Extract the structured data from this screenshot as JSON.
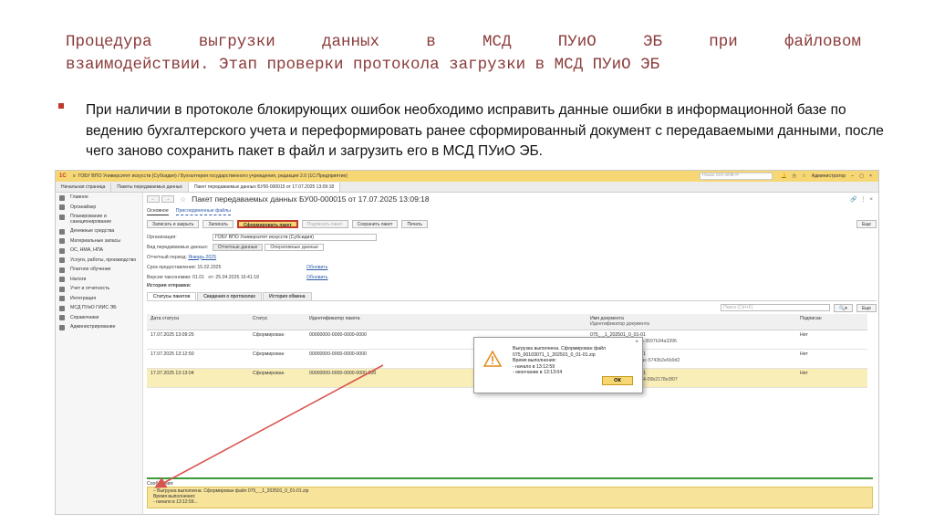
{
  "slide": {
    "title_line1": "Процедура выгрузки данных в МСД ПУиО ЭБ при файловом",
    "title_line2": "взаимодействии. Этап проверки протокола загрузки в МСД ПУиО ЭБ",
    "bullet": "При наличии в протоколе блокирующих ошибок необходимо исправить данные ошибки в информационной базе по ведению бухгалтерского учета и переформировать ранее сформированный документ с передаваемыми данными, после чего заново сохранить пакет в файл и загрузить его в МСД ПУиО ЭБ."
  },
  "colors": {
    "title": "#8b3a3a",
    "bullet": "#c0392b",
    "accent_yellow": "#f7d774",
    "highlight_red": "#c23a2b",
    "arrow_red": "#d9534f"
  },
  "app": {
    "logo": "1С",
    "window_title": "ГОБУ ВПО Университет искусств (Субсидия) / Бухгалтерия государственного учреждения, редакция 2.0 (1С:Предприятие)",
    "search_placeholder": "Поиск Ctrl+Shift+F",
    "user": "Администратор",
    "tabs": [
      "Начальная страница",
      "Пакеты передаваемых данных",
      "Пакет передаваемых данных БУ00-000015 от 17.07.2025 13:09:18"
    ]
  },
  "sidebar": {
    "items": [
      {
        "label": "Главное",
        "icon": "menu-icon"
      },
      {
        "label": "Органайзер",
        "icon": "calendar-icon"
      },
      {
        "label": "Планирование и санкционирование",
        "icon": "plan-icon"
      },
      {
        "label": "Денежные средства",
        "icon": "money-icon"
      },
      {
        "label": "Материальные запасы",
        "icon": "box-icon"
      },
      {
        "label": "ОС, НМА, НПА",
        "icon": "car-icon"
      },
      {
        "label": "Услуги, работы, производство",
        "icon": "tools-icon"
      },
      {
        "label": "Платное обучение",
        "icon": "edu-icon"
      },
      {
        "label": "Налоги",
        "icon": "tax-icon"
      },
      {
        "label": "Учет и отчетность",
        "icon": "report-icon"
      },
      {
        "label": "Интеграция",
        "icon": "integration-icon"
      },
      {
        "label": "МСД ПУиО ГИИС ЭБ",
        "icon": "msd-icon"
      },
      {
        "label": "Справочники",
        "icon": "book-icon"
      },
      {
        "label": "Администрирование",
        "icon": "gear-icon"
      }
    ]
  },
  "doc": {
    "title": "Пакет передаваемых данных БУ00-000015 от 17.07.2025 13:09:18",
    "link_main": "Основное",
    "link_files": "Присоединенные файлы",
    "btn_save_close": "Записать и закрыть",
    "btn_save": "Записать",
    "btn_form": "Сформировать пакет",
    "btn_sign": "Подписать пакет",
    "btn_save_pack": "Сохранить пакет",
    "btn_print": "Печать",
    "btn_more": "Еще",
    "org_label": "Организация:",
    "org_value": "ГОБУ ВПО Университет искусств (Субсидия)",
    "kind_label": "Вид передаваемых данных:",
    "kind_opt1": "Отчетные данные",
    "kind_opt2": "Оперативные данные",
    "period_label": "Отчетный период:",
    "period_value": "Январь 2025",
    "deadline_label": "Срок предоставления: 15.02.2025",
    "version_label": "Версия таксономии: 01.01",
    "version_date": "от: 25.04.2025 16:41:18",
    "refresh1": "Обновить",
    "refresh2": "Обновить",
    "history_label": "История отправки:",
    "tab1": "Статусы пакетов",
    "tab2": "Сведения о протоколах",
    "tab3": "История обмена",
    "grid_search": "Поиск (Ctrl+F)",
    "grid_more": "Еще"
  },
  "grid": {
    "headers": [
      "Дата статуса",
      "Статус",
      "Идентификатор пакета",
      "",
      "Имя документа",
      "Подписан"
    ],
    "header_sub": "Идентификатор документа",
    "rows": [
      {
        "date": "17.07.2025 13:09:25",
        "status": "Сформирован",
        "id": "00000000-0000-0000-0000",
        "name": "075_          _1_202501_0_01-01",
        "doc_id": "59baa66-1fe4-4e56-90ab-3697b34a3396",
        "signed": "Нет"
      },
      {
        "date": "17.07.2025 13:12:50",
        "status": "Сформирован",
        "id": "00000000-0000-0000-0000",
        "name": "075_          _1_202501_0_01-01",
        "doc_id": "73122a58-93ab-4c7c-98ac-5743b2e6b9d2",
        "signed": "Нет"
      },
      {
        "date": "17.07.2025 13:13:04",
        "status": "Сформирован",
        "id": "00000000-0000-0000-0000-000",
        "name": "075_          _1_202501_0_01-01",
        "doc_id": "d17ca7d6-1fce-4164-a514-09b2178e3f07",
        "signed": "Нет"
      }
    ]
  },
  "dialog": {
    "line1": "Выгрузка выполнена. Сформирован файл",
    "line2": "075_00103071_1_202501_0_01-01.zip",
    "line3": "Время выполнения:",
    "line4": "- начало в      13:12:59",
    "line5": "- окончание в 13:13:04",
    "ok": "ОК"
  },
  "messages": {
    "header": "Сообщения:",
    "line1": "– Выгрузка выполнена. Сформирован файл 075_            _1_202501_0_01-01.zip",
    "line2": "Время выполнения:",
    "line3": "- начало в 13:12:59..."
  }
}
